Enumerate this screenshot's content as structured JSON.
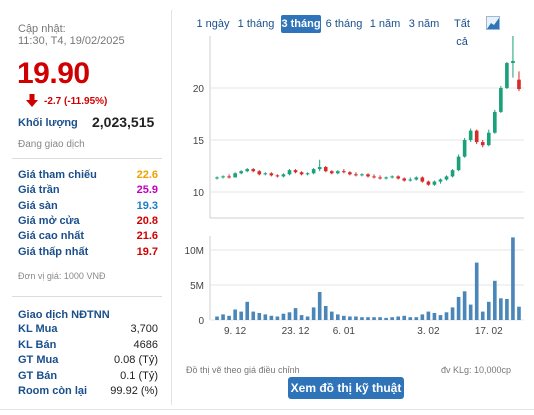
{
  "header": {
    "updated_label": "Cập nhật:",
    "updated_time": "11:30, T4, 19/02/2025",
    "price": "19.90",
    "change": "-2.7 (-11.95%)",
    "volume_label": "Khối lượng",
    "volume_value": "2,023,515",
    "status": "Đang giao dịch"
  },
  "price_table": [
    {
      "label": "Giá tham chiếu",
      "value": "22.6",
      "color": "#f0a000"
    },
    {
      "label": "Giá trần",
      "value": "25.9",
      "color": "#c000c0"
    },
    {
      "label": "Giá sàn",
      "value": "19.3",
      "color": "#1a7fc4"
    },
    {
      "label": "Giá mở cửa",
      "value": "20.8",
      "color": "#d10000"
    },
    {
      "label": "Giá cao nhất",
      "value": "21.6",
      "color": "#d10000"
    },
    {
      "label": "Giá thấp nhất",
      "value": "19.7",
      "color": "#d10000"
    }
  ],
  "unit_note": "Đơn vị giá: 1000 VNĐ",
  "foreign": {
    "title": "Giao dịch NĐTNN",
    "rows": [
      {
        "label": "KL Mua",
        "value": "3,700"
      },
      {
        "label": "KL Bán",
        "value": "4686"
      },
      {
        "label": "GT Mua",
        "value": "0.08 (Tỷ)"
      },
      {
        "label": "GT Bán",
        "value": "0.1 (Tỷ)"
      },
      {
        "label": "Room còn lại",
        "value": "99.92 (%)"
      }
    ]
  },
  "tabs": [
    "1 ngày",
    "1 tháng",
    "3 tháng",
    "6 tháng",
    "1 năm",
    "3 năm",
    "Tất cả"
  ],
  "active_tab": "3 tháng",
  "footnote_left": "Đồ thị vẽ theo giá điều chỉnh",
  "footnote_right": "đv KLg: 10,000cp",
  "tech_button": "Xem đồ thị kỹ thuật",
  "colors": {
    "up": "#1aa07a",
    "down": "#d62b2b",
    "volume": "#4a86b8"
  },
  "chart_data": {
    "type": "candlestick",
    "x_ticks": [
      "9. 12",
      "23. 12",
      "6. 01",
      "3. 02",
      "17. 02"
    ],
    "price_ticks": [
      10,
      15,
      20
    ],
    "volume_ticks": [
      "10M",
      "5M",
      "0"
    ],
    "price_range": [
      7.5,
      25
    ],
    "volume_range": [
      0,
      12
    ],
    "candles": [
      [
        11.3,
        11.5,
        11.2,
        11.4,
        0.5
      ],
      [
        11.4,
        11.6,
        11.3,
        11.5,
        0.8
      ],
      [
        11.5,
        11.7,
        11.3,
        11.4,
        0.6
      ],
      [
        11.4,
        11.9,
        11.4,
        11.8,
        1.5
      ],
      [
        11.8,
        12.1,
        11.7,
        12.0,
        1.2
      ],
      [
        12.0,
        12.3,
        11.9,
        12.2,
        2.6
      ],
      [
        12.2,
        12.3,
        11.9,
        12.0,
        1.2
      ],
      [
        12.0,
        12.1,
        11.6,
        11.7,
        1.0
      ],
      [
        11.7,
        11.9,
        11.6,
        11.8,
        0.8
      ],
      [
        11.8,
        11.9,
        11.5,
        11.6,
        0.6
      ],
      [
        11.6,
        11.7,
        11.4,
        11.5,
        0.5
      ],
      [
        11.5,
        11.8,
        11.4,
        11.7,
        0.9
      ],
      [
        11.7,
        12.2,
        11.6,
        12.1,
        1.1
      ],
      [
        12.1,
        12.2,
        11.8,
        11.9,
        1.7
      ],
      [
        11.9,
        12.0,
        11.6,
        11.7,
        0.7
      ],
      [
        11.7,
        11.9,
        11.6,
        11.8,
        0.5
      ],
      [
        11.8,
        12.3,
        11.7,
        12.2,
        1.8
      ],
      [
        12.2,
        13.1,
        12.0,
        12.4,
        4.0
      ],
      [
        12.4,
        12.5,
        11.9,
        12.0,
        2.0
      ],
      [
        12.0,
        12.1,
        11.7,
        11.8,
        1.2
      ],
      [
        11.8,
        12.1,
        11.7,
        12.0,
        0.8
      ],
      [
        12.0,
        12.2,
        11.8,
        11.9,
        0.6
      ],
      [
        11.9,
        12.0,
        11.6,
        11.7,
        0.5
      ],
      [
        11.7,
        11.9,
        11.5,
        11.6,
        0.5
      ],
      [
        11.6,
        11.8,
        11.5,
        11.7,
        0.4
      ],
      [
        11.7,
        11.8,
        11.4,
        11.5,
        0.4
      ],
      [
        11.5,
        11.7,
        11.3,
        11.4,
        0.4
      ],
      [
        11.4,
        11.6,
        11.2,
        11.3,
        0.4
      ],
      [
        11.3,
        11.5,
        11.2,
        11.4,
        0.3
      ],
      [
        11.4,
        11.6,
        11.3,
        11.5,
        0.4
      ],
      [
        11.5,
        11.6,
        11.2,
        11.3,
        0.5
      ],
      [
        11.3,
        11.4,
        11.0,
        11.1,
        0.6
      ],
      [
        11.1,
        11.4,
        11.0,
        11.2,
        0.4
      ],
      [
        11.2,
        11.5,
        11.1,
        11.4,
        0.4
      ],
      [
        11.4,
        11.5,
        10.9,
        11.0,
        0.8
      ],
      [
        11.0,
        11.1,
        10.6,
        10.7,
        1.2
      ],
      [
        10.7,
        11.1,
        10.6,
        11.0,
        1.0
      ],
      [
        11.0,
        11.3,
        10.8,
        11.2,
        0.7
      ],
      [
        11.2,
        11.6,
        11.1,
        11.5,
        1.1
      ],
      [
        11.5,
        12.2,
        11.4,
        12.1,
        1.8
      ],
      [
        12.1,
        13.6,
        12.0,
        13.4,
        3.3
      ],
      [
        13.4,
        15.2,
        13.3,
        15.0,
        4.1
      ],
      [
        15.0,
        16.1,
        14.8,
        15.9,
        2.2
      ],
      [
        15.9,
        16.0,
        14.6,
        14.8,
        8.2
      ],
      [
        14.8,
        15.0,
        14.3,
        14.5,
        1.2
      ],
      [
        14.5,
        16.0,
        14.4,
        15.7,
        2.6
      ],
      [
        15.7,
        17.9,
        15.6,
        17.7,
        5.6
      ],
      [
        17.7,
        20.2,
        17.6,
        20.0,
        3.1
      ],
      [
        20.0,
        22.5,
        19.9,
        22.4,
        3.0
      ],
      [
        22.4,
        25.0,
        21.0,
        22.6,
        11.8
      ],
      [
        20.8,
        21.6,
        19.7,
        19.9,
        1.9
      ]
    ]
  }
}
